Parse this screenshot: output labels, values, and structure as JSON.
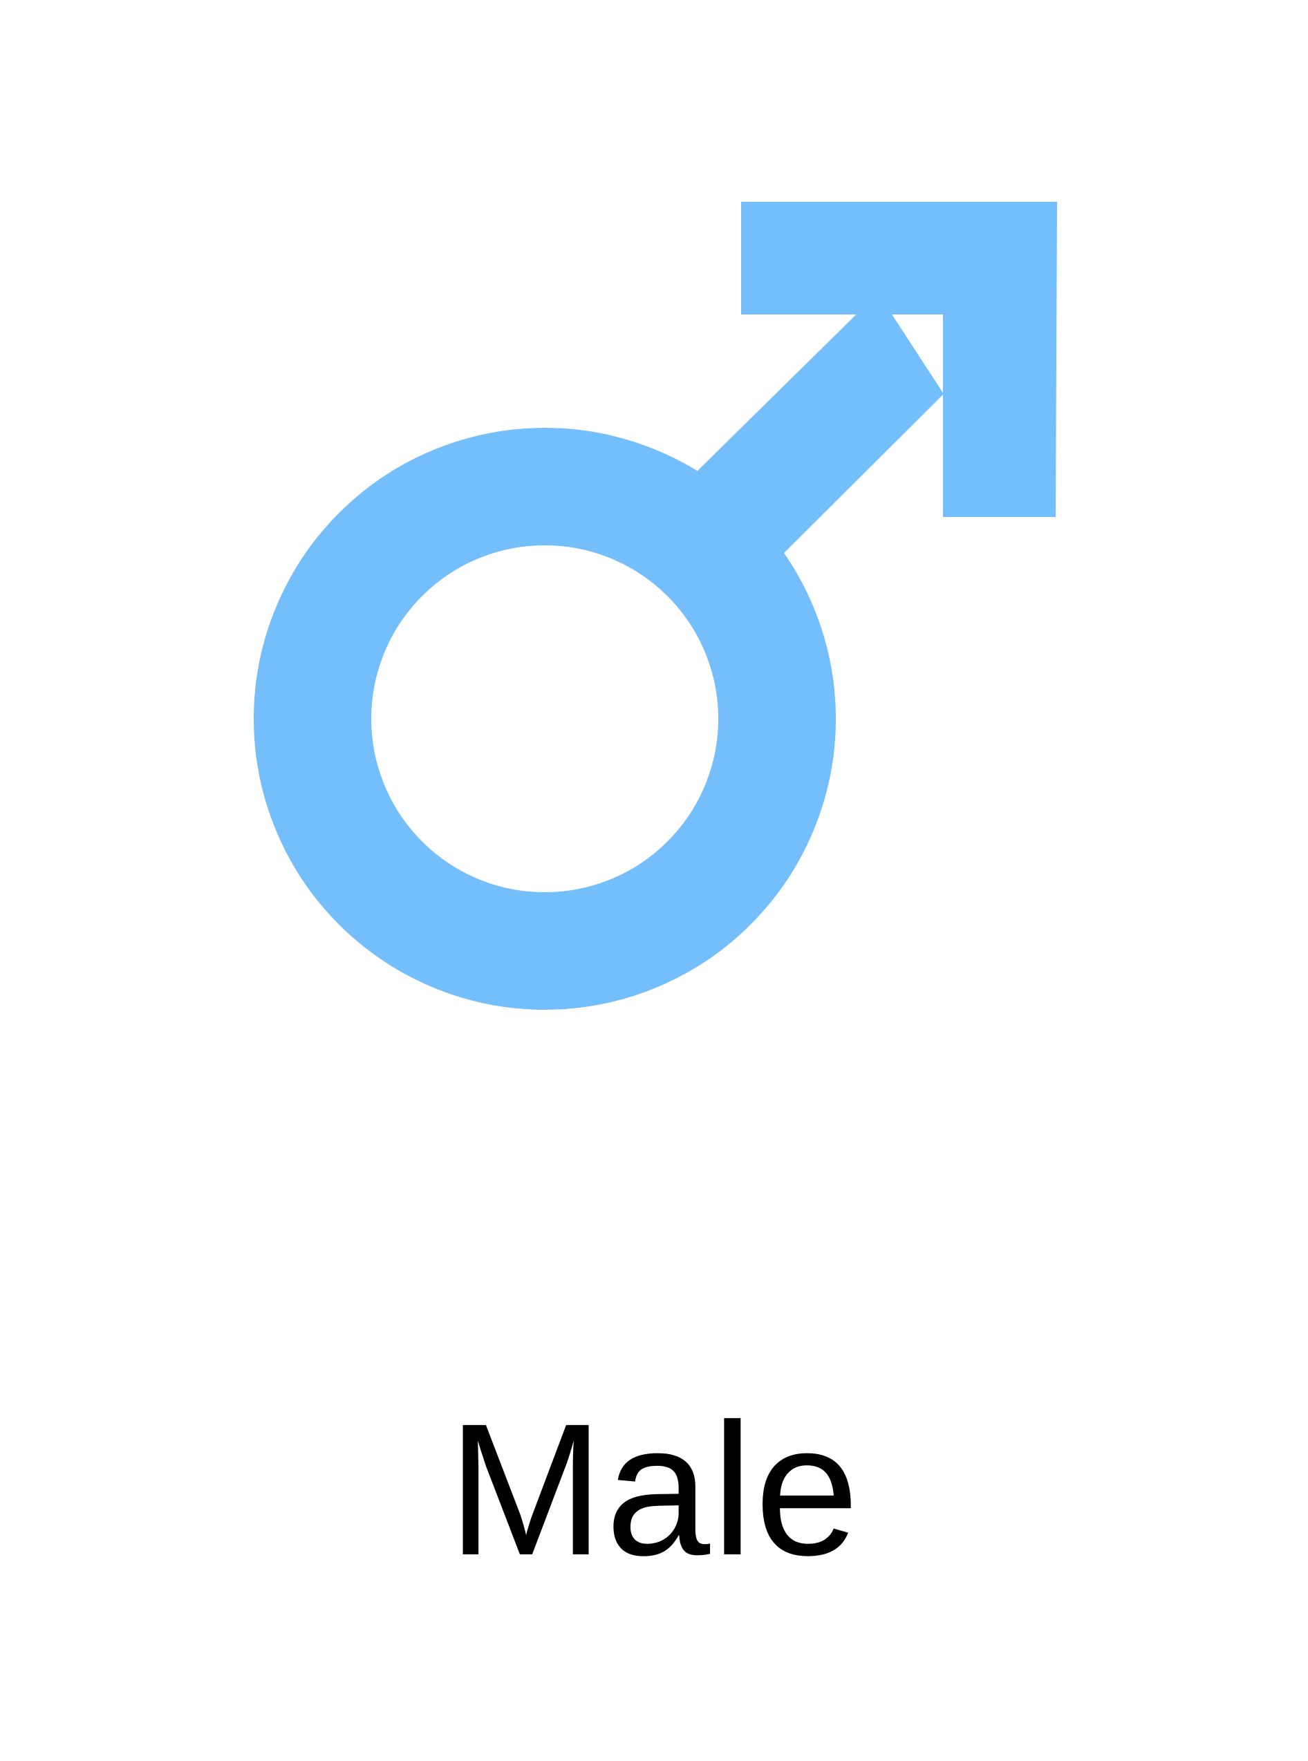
{
  "symbol": {
    "icon": "male-symbol-icon",
    "color": "#75BEFC"
  },
  "label": {
    "text": "Male"
  }
}
